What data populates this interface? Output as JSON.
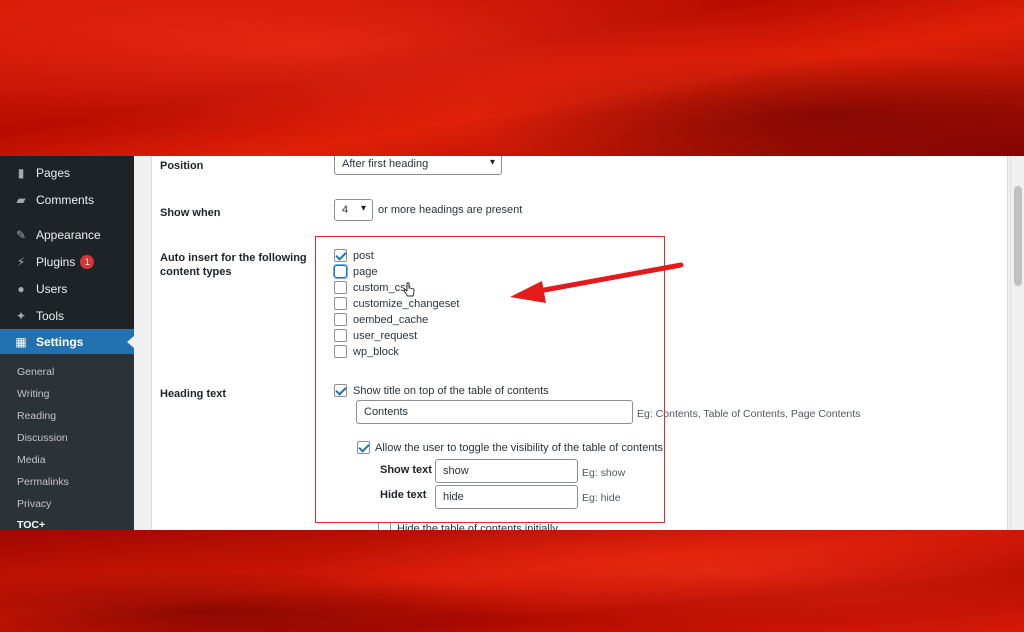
{
  "sidebar": {
    "items": [
      {
        "label": "Pages",
        "icon": "pages-icon"
      },
      {
        "label": "Comments",
        "icon": "comments-icon"
      },
      {
        "label": "Appearance",
        "icon": "appearance-icon"
      },
      {
        "label": "Plugins",
        "icon": "plugins-icon",
        "badge": "1"
      },
      {
        "label": "Users",
        "icon": "users-icon"
      },
      {
        "label": "Tools",
        "icon": "tools-icon"
      },
      {
        "label": "Settings",
        "icon": "settings-icon"
      }
    ],
    "submenu": [
      "General",
      "Writing",
      "Reading",
      "Discussion",
      "Media",
      "Permalinks",
      "Privacy",
      "TOC+"
    ]
  },
  "form": {
    "position": {
      "label": "Position",
      "value": "After first heading"
    },
    "show_when": {
      "label": "Show when",
      "value": "4",
      "suffix": "or more headings are present"
    },
    "auto_insert": {
      "label": "Auto insert for the following content types",
      "options": [
        {
          "label": "post",
          "checked": true
        },
        {
          "label": "page",
          "checked": false
        },
        {
          "label": "custom_css",
          "checked": false
        },
        {
          "label": "customize_changeset",
          "checked": false
        },
        {
          "label": "oembed_cache",
          "checked": false
        },
        {
          "label": "user_request",
          "checked": false
        },
        {
          "label": "wp_block",
          "checked": false
        }
      ]
    },
    "heading_text": {
      "label": "Heading text",
      "show_title_label": "Show title on top of the table of contents",
      "title_value": "Contents",
      "title_hint": "Eg: Contents, Table of Contents, Page Contents",
      "toggle_label": "Allow the user to toggle the visibility of the table of contents",
      "show_text_label": "Show text",
      "show_text_value": "show",
      "show_text_hint": "Eg: show",
      "hide_text_label": "Hide text",
      "hide_text_value": "hide",
      "hide_text_hint": "Eg: hide",
      "hide_initially_label": "Hide the table of contents initially"
    }
  },
  "colors": {
    "accent": "#2271b1",
    "annotation": "#e02a2a",
    "sidebar_bg": "#1d2327",
    "badge": "#d63638"
  }
}
